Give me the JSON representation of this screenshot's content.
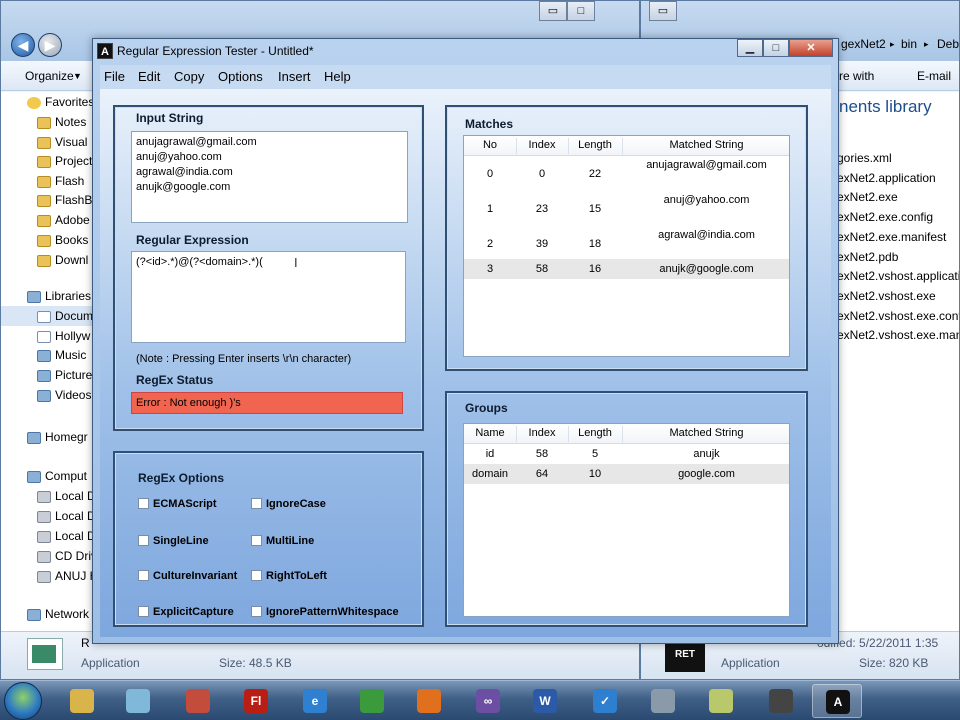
{
  "background_left": {
    "toolbar": {
      "organize": "Organize"
    },
    "nav_items": [
      {
        "label": "Favorites",
        "icon": "star-icon",
        "kind": "head"
      },
      {
        "label": "Notes",
        "icon": "folder-icon"
      },
      {
        "label": "Visual",
        "icon": "folder-icon"
      },
      {
        "label": "Project",
        "icon": "folder-icon"
      },
      {
        "label": "Flash",
        "icon": "folder-icon"
      },
      {
        "label": "FlashB",
        "icon": "folder-icon"
      },
      {
        "label": "Adobe",
        "icon": "folder-icon"
      },
      {
        "label": "Books",
        "icon": "folder-icon"
      },
      {
        "label": "Downl",
        "icon": "folder-icon"
      },
      {
        "label": "Libraries",
        "icon": "library-icon",
        "kind": "head"
      },
      {
        "label": "Docum",
        "icon": "document-icon"
      },
      {
        "label": "Hollyw",
        "icon": "document-icon"
      },
      {
        "label": "Music",
        "icon": "music-icon"
      },
      {
        "label": "Picture",
        "icon": "picture-icon"
      },
      {
        "label": "Videos",
        "icon": "video-icon"
      },
      {
        "label": "Homegr",
        "icon": "homegroup-icon",
        "kind": "head"
      },
      {
        "label": "Comput",
        "icon": "computer-icon",
        "kind": "head"
      },
      {
        "label": "Local D",
        "icon": "drive-icon"
      },
      {
        "label": "Local D",
        "icon": "drive-icon"
      },
      {
        "label": "Local D",
        "icon": "drive-icon"
      },
      {
        "label": "CD Driv",
        "icon": "cd-drive-icon"
      },
      {
        "label": "ANUJ H",
        "icon": "drive-icon"
      },
      {
        "label": "Network",
        "icon": "network-icon",
        "kind": "head"
      }
    ],
    "status": {
      "name": "R",
      "type": "Application",
      "size": "Size: 48.5 KB"
    }
  },
  "background_right": {
    "breadcrumb": [
      "gexNet2",
      "bin",
      "Debu"
    ],
    "toolbar": {
      "share": "re with",
      "email": "E-mail"
    },
    "library_title": "nents library",
    "files": [
      "gories.xml",
      "exNet2.application",
      "exNet2.exe",
      "exNet2.exe.config",
      "exNet2.exe.manifest",
      "exNet2.pdb",
      "exNet2.vshost.application",
      "exNet2.vshost.exe",
      "exNet2.vshost.exe.config",
      "exNet2.vshost.exe.manife"
    ],
    "status": {
      "modified": "odified: 5/22/2011 1:35",
      "type": "Application",
      "size": "Size: 820 KB"
    }
  },
  "app": {
    "title": "Regular Expression Tester - Untitled*",
    "icon_label": "A",
    "menu": [
      "File",
      "Edit",
      "Copy",
      "Options",
      "Insert",
      "Help"
    ],
    "input_panel": {
      "title": "Input String",
      "lines": [
        "anujagrawal@gmail.com",
        "anuj@yahoo.com",
        "agrawal@india.com",
        "anujk@google.com"
      ]
    },
    "regex_panel": {
      "title": "Regular Expression",
      "value": "(?<id>.*)@(?<domain>.*)(",
      "note": "(Note : Pressing Enter inserts \\r\\n character)"
    },
    "status_panel": {
      "title": "RegEx Status",
      "message": "Error : Not enough )'s",
      "color": "#f1644f"
    },
    "options_panel": {
      "title": "RegEx Options",
      "options": [
        {
          "label": "ECMAScript",
          "checked": false
        },
        {
          "label": "IgnoreCase",
          "checked": false
        },
        {
          "label": "SingleLine",
          "checked": false
        },
        {
          "label": "MultiLine",
          "checked": false
        },
        {
          "label": "CultureInvariant",
          "checked": false
        },
        {
          "label": "RightToLeft",
          "checked": false
        },
        {
          "label": "ExplicitCapture",
          "checked": false
        },
        {
          "label": "IgnorePatternWhitespace",
          "checked": false
        }
      ]
    },
    "matches_panel": {
      "title": "Matches",
      "columns": [
        "No",
        "Index",
        "Length",
        "Matched String"
      ],
      "rows": [
        [
          "0",
          "0",
          "22",
          "anujagrawal@gmail.com"
        ],
        [
          "1",
          "23",
          "15",
          "anuj@yahoo.com"
        ],
        [
          "2",
          "39",
          "18",
          "agrawal@india.com"
        ],
        [
          "3",
          "58",
          "16",
          "anujk@google.com"
        ]
      ],
      "selected_row": 3
    },
    "groups_panel": {
      "title": "Groups",
      "columns": [
        "Name",
        "Index",
        "Length",
        "Matched String"
      ],
      "rows": [
        [
          "id",
          "58",
          "5",
          "anujk"
        ],
        [
          "domain",
          "64",
          "10",
          "google.com"
        ]
      ],
      "selected_row": 1
    }
  },
  "taskbar": {
    "items": [
      {
        "name": "explorer-taskbar-icon",
        "glyph": "",
        "color": "#d9b44a"
      },
      {
        "name": "notepad-taskbar-icon",
        "glyph": "",
        "color": "#7fb8d8"
      },
      {
        "name": "paint-taskbar-icon",
        "glyph": "",
        "color": "#c44c3c"
      },
      {
        "name": "flash-taskbar-icon",
        "glyph": "Fl",
        "color": "#b81e14"
      },
      {
        "name": "internet-explorer-taskbar-icon",
        "glyph": "e",
        "color": "#2f80d0"
      },
      {
        "name": "chrome-taskbar-icon",
        "glyph": "",
        "color": "#3b9a3b"
      },
      {
        "name": "firefox-taskbar-icon",
        "glyph": "",
        "color": "#e0701e"
      },
      {
        "name": "visual-studio-taskbar-icon",
        "glyph": "∞",
        "color": "#6c4fa3"
      },
      {
        "name": "word-taskbar-icon",
        "glyph": "W",
        "color": "#2b5aa8"
      },
      {
        "name": "checklist-taskbar-icon",
        "glyph": "✓",
        "color": "#2f7fd0"
      },
      {
        "name": "computer-taskbar-icon",
        "glyph": "",
        "color": "#8a9aa8"
      },
      {
        "name": "paint-dot-net-taskbar-icon",
        "glyph": "",
        "color": "#b8c86a"
      },
      {
        "name": "media-taskbar-icon",
        "glyph": "",
        "color": "#444444"
      },
      {
        "name": "regex-tester-taskbar-icon",
        "glyph": "A",
        "color": "#111111"
      }
    ]
  }
}
